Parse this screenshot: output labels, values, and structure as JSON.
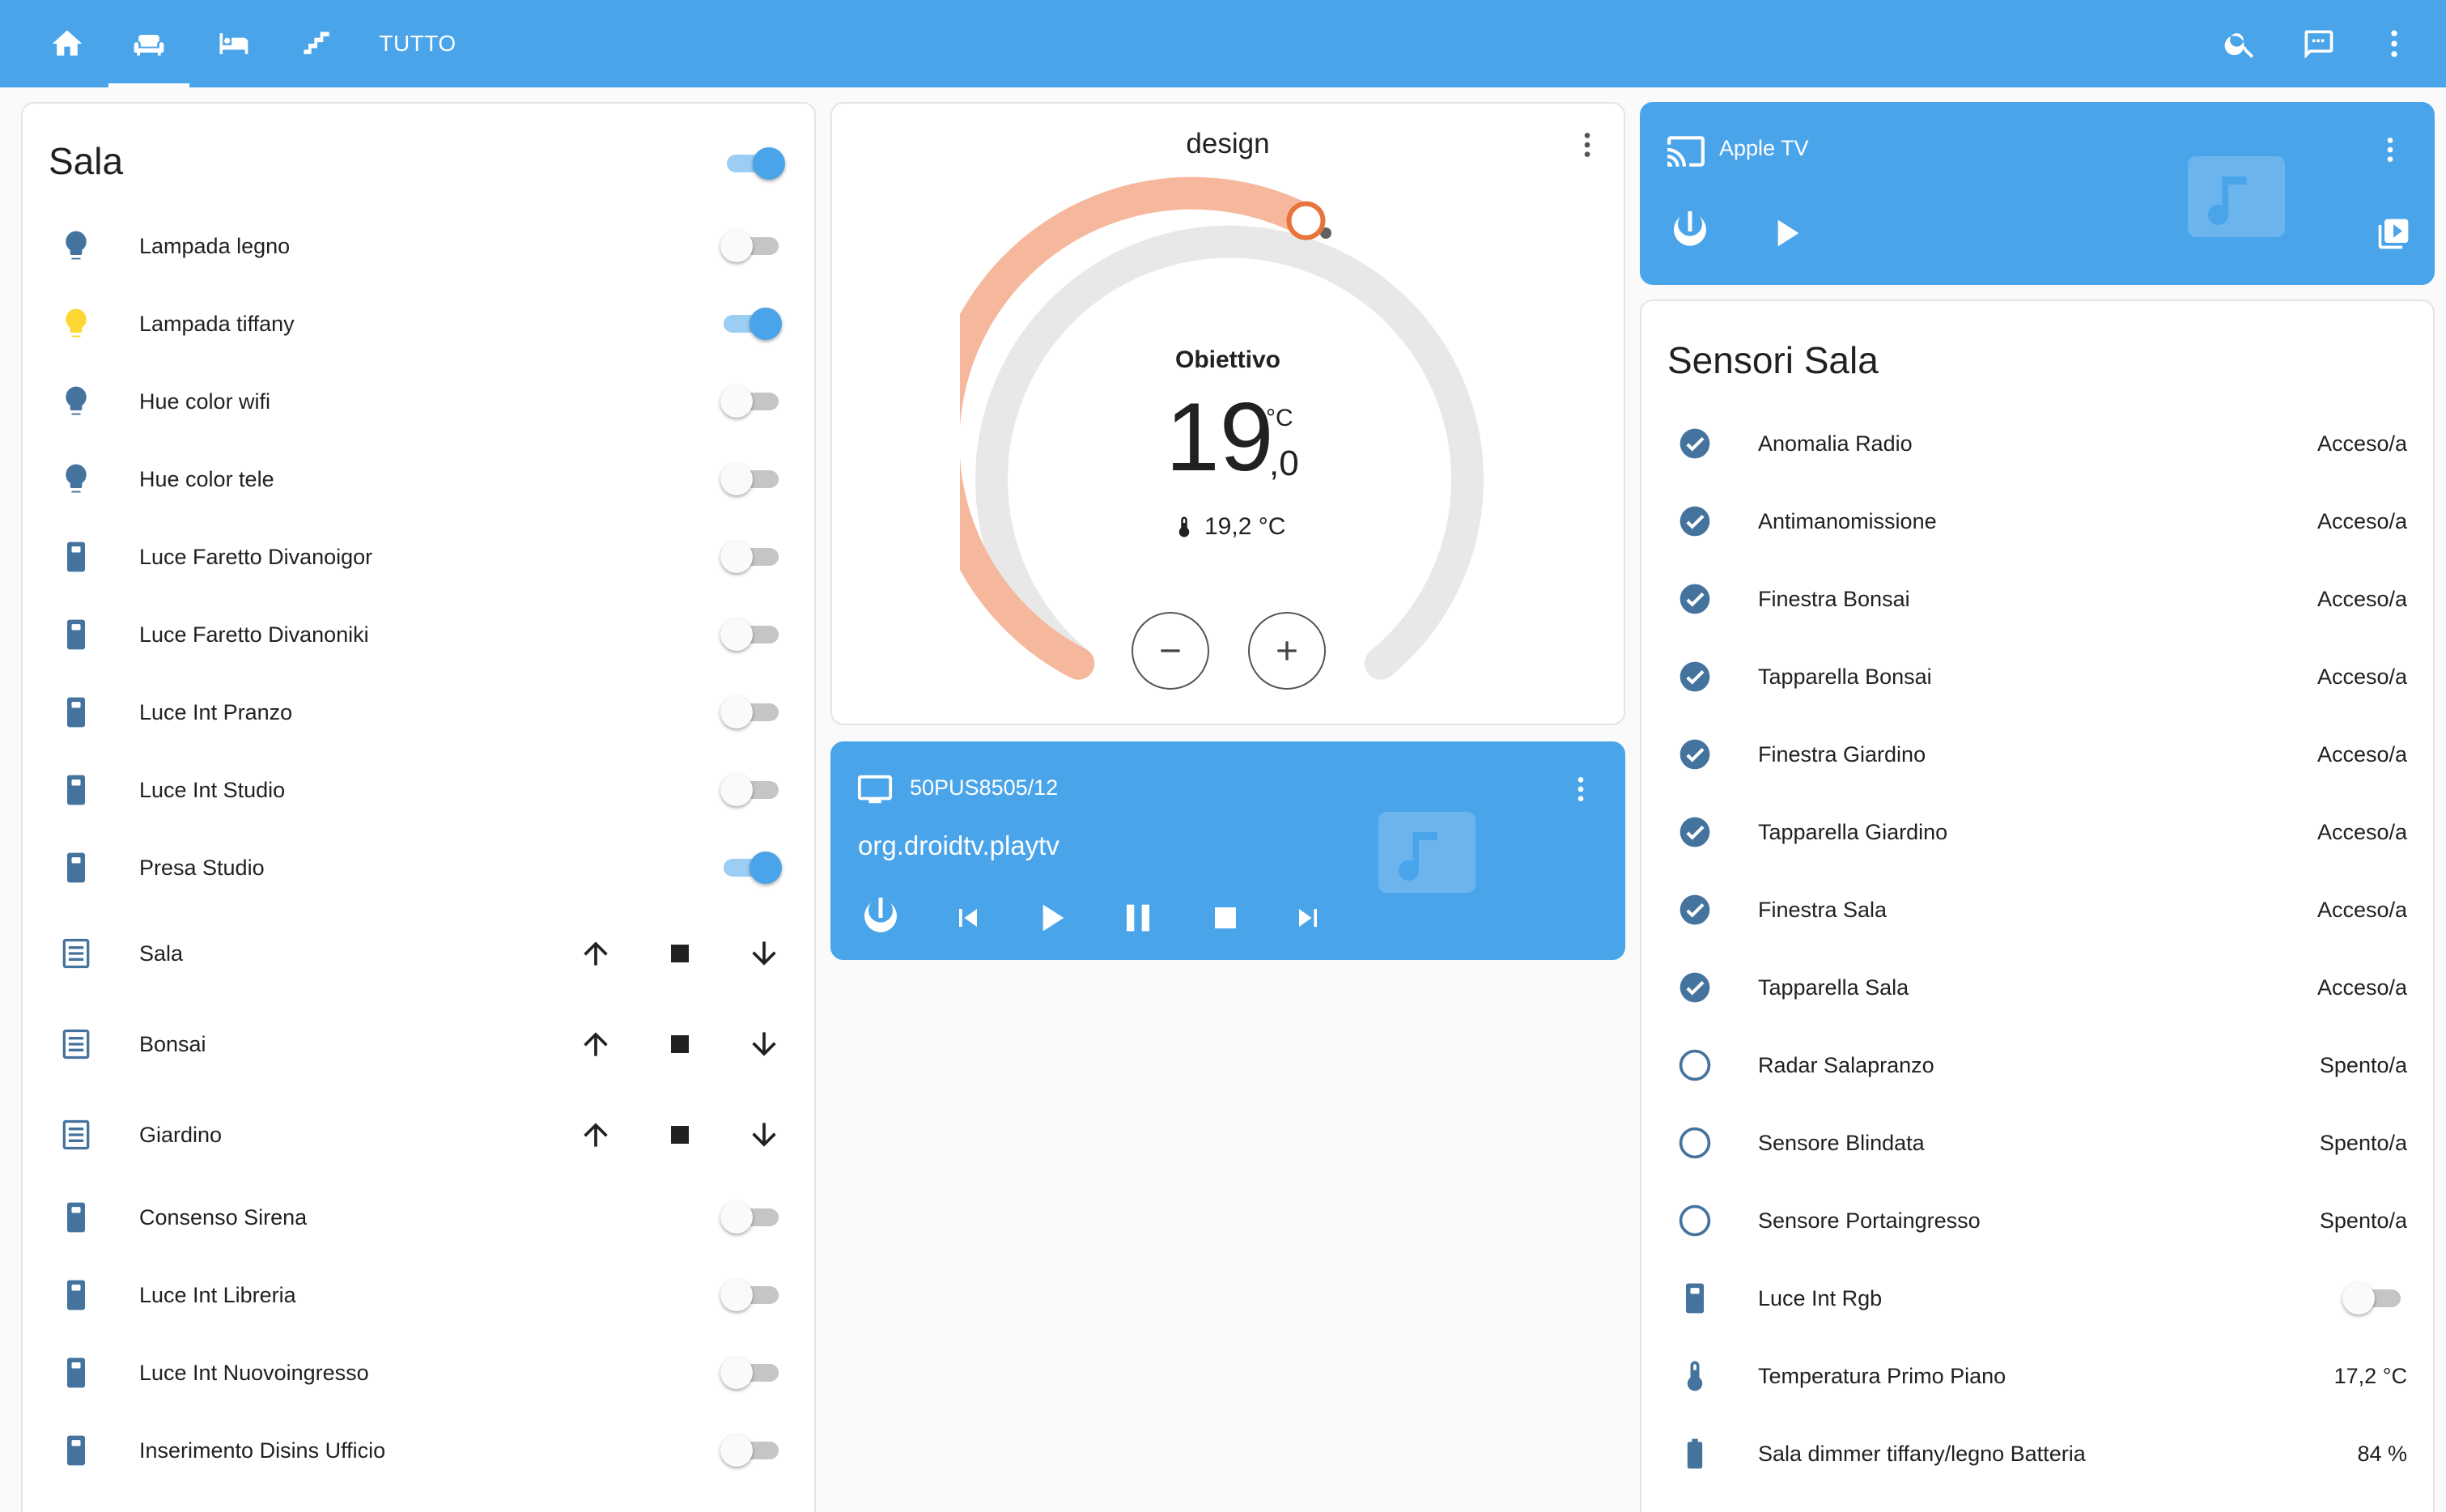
{
  "header": {
    "tabs": [
      {
        "icon": "home-icon"
      },
      {
        "icon": "sofa-icon"
      },
      {
        "icon": "bed-icon"
      },
      {
        "icon": "stairs-icon"
      }
    ],
    "text_tab": "TUTTO",
    "actions": [
      "search-icon",
      "assist-icon",
      "more-vert-icon"
    ],
    "accent": "#4aa4ea"
  },
  "sala": {
    "title": "Sala",
    "master_on": true,
    "items": [
      {
        "label": "Lampada legno",
        "icon": "bulb-icon",
        "on": false
      },
      {
        "label": "Lampada tiffany",
        "icon": "bulb-icon",
        "on": true
      },
      {
        "label": "Hue color wifi",
        "icon": "bulb-icon",
        "on": false
      },
      {
        "label": "Hue color tele",
        "icon": "bulb-icon",
        "on": false
      },
      {
        "label": "Luce Faretto Divanoigor",
        "icon": "switch-icon",
        "on": false
      },
      {
        "label": "Luce Faretto Divanoniki",
        "icon": "switch-icon",
        "on": false
      },
      {
        "label": "Luce Int Pranzo",
        "icon": "switch-icon",
        "on": false
      },
      {
        "label": "Luce Int Studio",
        "icon": "switch-icon",
        "on": false
      },
      {
        "label": "Presa Studio",
        "icon": "switch-icon",
        "on": true
      }
    ],
    "covers": [
      {
        "label": "Sala"
      },
      {
        "label": "Bonsai"
      },
      {
        "label": "Giardino"
      }
    ],
    "items2": [
      {
        "label": "Consenso Sirena",
        "icon": "switch-icon",
        "on": false
      },
      {
        "label": "Luce Int Libreria",
        "icon": "switch-icon",
        "on": false
      },
      {
        "label": "Luce Int Nuovoingresso",
        "icon": "switch-icon",
        "on": false
      },
      {
        "label": "Inserimento Disins Ufficio",
        "icon": "switch-icon",
        "on": false
      }
    ]
  },
  "thermostat": {
    "name": "design",
    "label": "Obiettivo",
    "target_int": "19",
    "target_dec": ",0",
    "unit": "°C",
    "current": "19,2 °C",
    "heat_color": "#f6b89c",
    "handle_color": "#e8743b"
  },
  "tv": {
    "name": "50PUS8505/12",
    "app": "org.droidtv.playtv"
  },
  "apple_tv": {
    "name": "Apple TV"
  },
  "sensori": {
    "title": "Sensori Sala",
    "items": [
      {
        "label": "Anomalia Radio",
        "value": "Acceso/a",
        "state": "on"
      },
      {
        "label": "Antimanomissione",
        "value": "Acceso/a",
        "state": "on"
      },
      {
        "label": "Finestra Bonsai",
        "value": "Acceso/a",
        "state": "on"
      },
      {
        "label": "Tapparella Bonsai",
        "value": "Acceso/a",
        "state": "on"
      },
      {
        "label": "Finestra Giardino",
        "value": "Acceso/a",
        "state": "on"
      },
      {
        "label": "Tapparella Giardino",
        "value": "Acceso/a",
        "state": "on"
      },
      {
        "label": "Finestra Sala",
        "value": "Acceso/a",
        "state": "on"
      },
      {
        "label": "Tapparella Sala",
        "value": "Acceso/a",
        "state": "on"
      },
      {
        "label": "Radar Salapranzo",
        "value": "Spento/a",
        "state": "off"
      },
      {
        "label": "Sensore Blindata",
        "value": "Spento/a",
        "state": "off"
      },
      {
        "label": "Sensore Portaingresso",
        "value": "Spento/a",
        "state": "off"
      }
    ],
    "luce_rgb": {
      "label": "Luce Int Rgb",
      "on": false
    },
    "temperatura": {
      "label": "Temperatura Primo Piano",
      "value": "17,2 °C"
    },
    "batteria": {
      "label": "Sala dimmer tiffany/legno Batteria",
      "value": "84 %"
    }
  }
}
